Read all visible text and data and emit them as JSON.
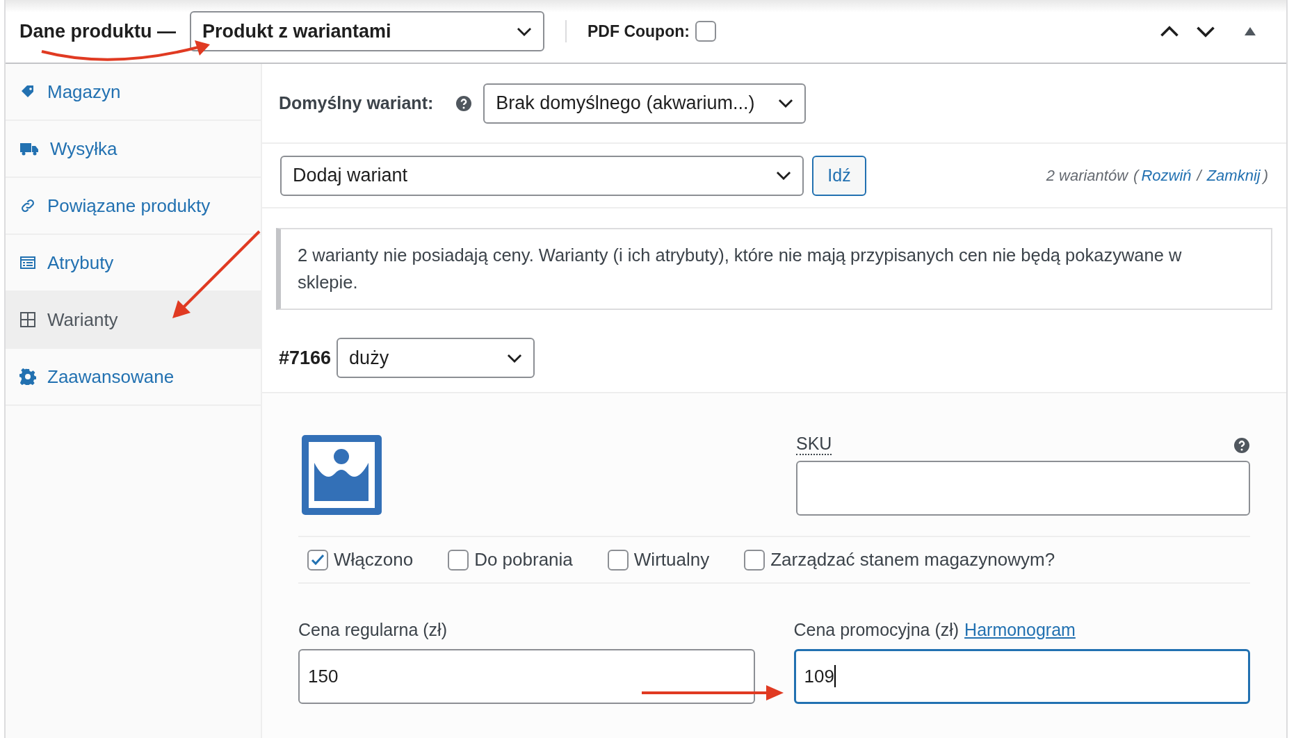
{
  "header": {
    "title": "Dane produktu —",
    "product_type": "Produkt z wariantami",
    "pdf_coupon": {
      "label": "PDF Coupon:",
      "checked": false
    }
  },
  "sidebar": {
    "items": [
      {
        "label": "Magazyn",
        "selected": false
      },
      {
        "label": "Wysyłka",
        "selected": false
      },
      {
        "label": "Powiązane produkty",
        "selected": false
      },
      {
        "label": "Atrybuty",
        "selected": false
      },
      {
        "label": "Warianty",
        "selected": true
      },
      {
        "label": "Zaawansowane",
        "selected": false
      }
    ]
  },
  "default_variant": {
    "label": "Domyślny wariant:",
    "value": "Brak domyślnego (akwarium...)"
  },
  "add_variant": {
    "value": "Dodaj wariant",
    "button": "Idź"
  },
  "variant_count": {
    "text": "2 wariantów",
    "open": "(",
    "expand": "Rozwiń",
    "separator": "/",
    "collapse": "Zamknij",
    "close": ")"
  },
  "notice": "2 warianty nie posiadają ceny. Warianty (i ich atrybuty), które nie mają przypisanych cen nie będą pokazywane w sklepie.",
  "variant": {
    "id": "#7166",
    "attribute": "duży",
    "sku": {
      "label": "SKU"
    },
    "options": [
      {
        "label": "Włączono",
        "checked": true
      },
      {
        "label": "Do pobrania",
        "checked": false
      },
      {
        "label": "Wirtualny",
        "checked": false
      },
      {
        "label": "Zarządzać stanem magazynowym?",
        "checked": false
      }
    ],
    "regular_price": {
      "label": "Cena regularna (zł)",
      "value": "150",
      "focused": false
    },
    "sale_price": {
      "label": "Cena promocyjna (zł)",
      "link": "Harmonogram",
      "value": "109",
      "focused": true
    }
  }
}
